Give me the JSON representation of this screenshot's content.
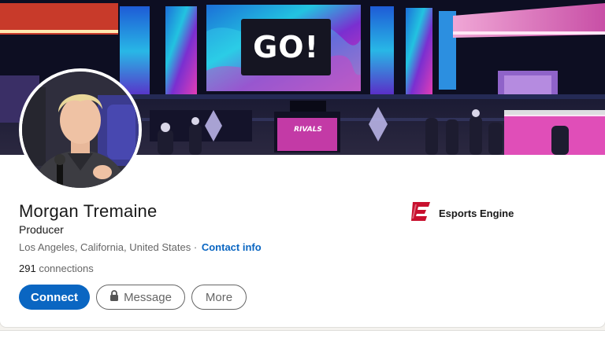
{
  "banner": {
    "screen_text": "GO!",
    "stage_sign": "RIVALS"
  },
  "profile": {
    "name": "Morgan Tremaine",
    "headline": "Producer",
    "location": "Los Angeles, California, United States",
    "separator": "·",
    "contact_label": "Contact info",
    "connections_count": "291",
    "connections_label": "connections"
  },
  "company": {
    "name": "Esports Engine",
    "logo_icon": "esports-engine-logo",
    "brand_color": "#c8102e"
  },
  "actions": {
    "connect_label": "Connect",
    "message_label": "Message",
    "message_icon": "lock-icon",
    "more_label": "More"
  },
  "colors": {
    "accent": "#0a66c2",
    "muted_text": "#666666"
  }
}
